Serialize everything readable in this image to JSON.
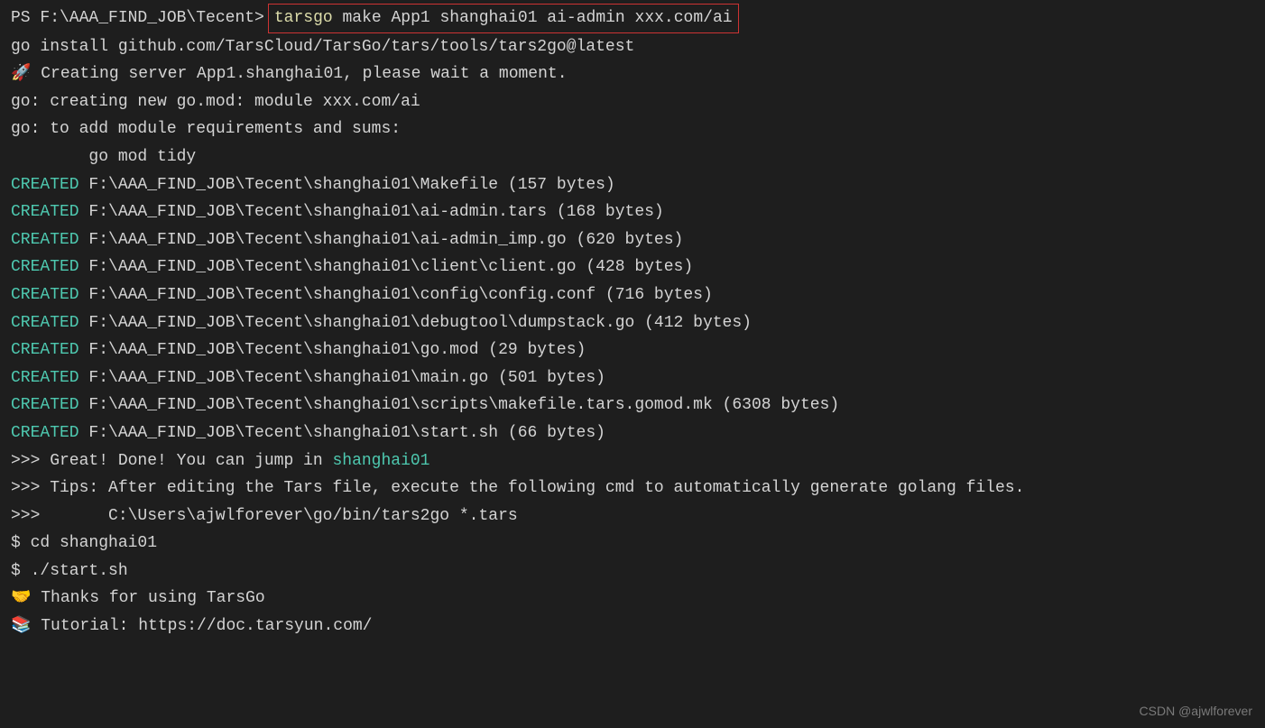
{
  "prompt": {
    "path": "PS F:\\AAA_FIND_JOB\\Tecent>",
    "cmd_first": "tarsgo",
    "cmd_rest": " make App1 shanghai01 ai-admin xxx.com/ai"
  },
  "lines": {
    "install": "go install github.com/TarsCloud/TarsGo/tars/tools/tars2go@latest",
    "creating": "🚀 Creating server App1.shanghai01, please wait a moment.",
    "blank1": "",
    "gomod1": "go: creating new go.mod: module xxx.com/ai",
    "gomod2": "go: to add module requirements and sums:",
    "gomod3": "        go mod tidy",
    "blank2": ""
  },
  "created": [
    {
      "label": "CREATED",
      "path": " F:\\AAA_FIND_JOB\\Tecent\\shanghai01\\Makefile (157 bytes)"
    },
    {
      "label": "CREATED",
      "path": " F:\\AAA_FIND_JOB\\Tecent\\shanghai01\\ai-admin.tars (168 bytes)"
    },
    {
      "label": "CREATED",
      "path": " F:\\AAA_FIND_JOB\\Tecent\\shanghai01\\ai-admin_imp.go (620 bytes)"
    },
    {
      "label": "CREATED",
      "path": " F:\\AAA_FIND_JOB\\Tecent\\shanghai01\\client\\client.go (428 bytes)"
    },
    {
      "label": "CREATED",
      "path": " F:\\AAA_FIND_JOB\\Tecent\\shanghai01\\config\\config.conf (716 bytes)"
    },
    {
      "label": "CREATED",
      "path": " F:\\AAA_FIND_JOB\\Tecent\\shanghai01\\debugtool\\dumpstack.go (412 bytes)"
    },
    {
      "label": "CREATED",
      "path": " F:\\AAA_FIND_JOB\\Tecent\\shanghai01\\go.mod (29 bytes)"
    },
    {
      "label": "CREATED",
      "path": " F:\\AAA_FIND_JOB\\Tecent\\shanghai01\\main.go (501 bytes)"
    },
    {
      "label": "CREATED",
      "path": " F:\\AAA_FIND_JOB\\Tecent\\shanghai01\\scripts\\makefile.tars.gomod.mk (6308 bytes)"
    },
    {
      "label": "CREATED",
      "path": " F:\\AAA_FIND_JOB\\Tecent\\shanghai01\\start.sh (66 bytes)"
    }
  ],
  "footer": {
    "blank3": "",
    "great_prefix": ">>> Great! Done! You can jump in ",
    "great_target": "shanghai01",
    "tips": ">>> Tips: After editing the Tars file, execute the following cmd to automatically generate golang files.",
    "tips_cmd": ">>>       C:\\Users\\ajwlforever\\go/bin/tars2go *.tars",
    "cd": "$ cd shanghai01",
    "start": "$ ./start.sh",
    "thanks": "🤝 Thanks for using TarsGo",
    "tutorial": "📚 Tutorial: https://doc.tarsyun.com/"
  },
  "watermark": "CSDN @ajwlforever"
}
